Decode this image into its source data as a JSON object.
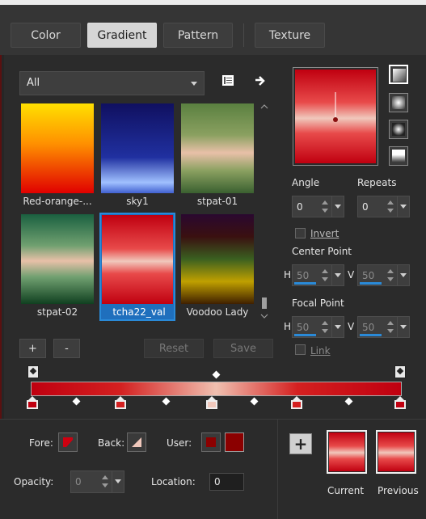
{
  "tabs": [
    {
      "label": "Color",
      "active": false
    },
    {
      "label": "Gradient",
      "active": true
    },
    {
      "label": "Pattern",
      "active": false
    },
    {
      "label": "Texture",
      "active": false
    }
  ],
  "filter": {
    "selected": "All"
  },
  "swatches": [
    {
      "label": "Red-orange-...",
      "colors": [
        "#ffe000",
        "#ff8000",
        "#e00000"
      ],
      "selected": false
    },
    {
      "label": "sky1",
      "colors": [
        "#101060",
        "#2030a0",
        "#a0c0ff"
      ],
      "selected": false
    },
    {
      "label": "stpat-01",
      "colors": [
        "#5a8040",
        "#e8c0a8",
        "#3a6030"
      ],
      "selected": false
    },
    {
      "label": "stpat-02",
      "colors": [
        "#1a6040",
        "#e8c0a8",
        "#104020"
      ],
      "selected": false
    },
    {
      "label": "tcha22_val",
      "colors": [
        "#c00010",
        "#f0c8bc",
        "#c00010"
      ],
      "selected": true
    },
    {
      "label": "Voodoo Lady",
      "colors": [
        "#2a0830",
        "#3a6020",
        "#c0a000"
      ],
      "selected": false
    }
  ],
  "buttons": {
    "add": "+",
    "remove": "-",
    "reset": "Reset",
    "save": "Save",
    "new_swatch": "+"
  },
  "angle": {
    "label": "Angle",
    "value": "0"
  },
  "repeats": {
    "label": "Repeats",
    "value": "0"
  },
  "invert": {
    "label": "Invert",
    "checked": false
  },
  "center_point": {
    "label": "Center Point",
    "h_label": "H",
    "h": "50",
    "v_label": "V",
    "v": "50"
  },
  "focal_point": {
    "label": "Focal Point",
    "h_label": "H",
    "h": "50",
    "v_label": "V",
    "v": "50"
  },
  "link": {
    "label": "Link",
    "checked": false
  },
  "fore": {
    "label": "Fore:"
  },
  "back": {
    "label": "Back:"
  },
  "user": {
    "label": "User:",
    "color": "#8b0000"
  },
  "opacity": {
    "label": "Opacity:",
    "value": "0"
  },
  "location": {
    "label": "Location:",
    "value": "0"
  },
  "current_label": "Current",
  "previous_label": "Previous",
  "accent_color": "#2a8ad8"
}
